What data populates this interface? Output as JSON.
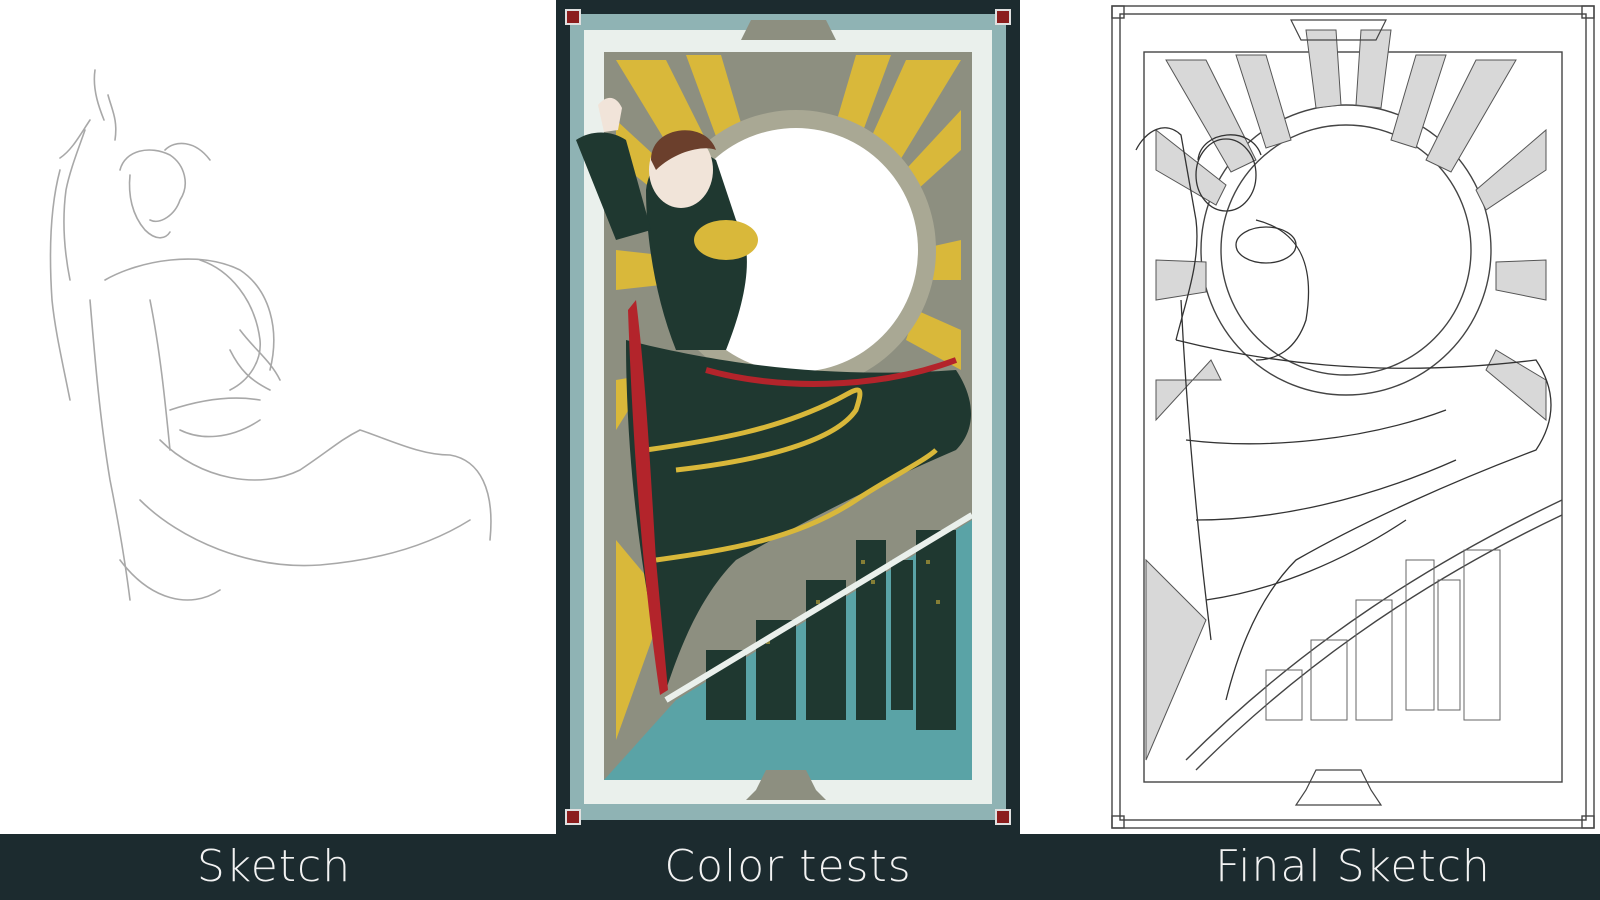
{
  "captions": {
    "sketch": "Sketch",
    "color": "Color tests",
    "final": "Final Sketch"
  },
  "colors": {
    "caption_bar": "#1c2b2f",
    "caption_text": "#f2f2f2",
    "frame_dark": "#1c2b2f",
    "frame_teal": "#8fb3b4",
    "gold": "#d9b83a",
    "grey_ray": "#8d8f80",
    "coat_green": "#1f3830",
    "sky_teal": "#5aa3a6",
    "sash_red": "#b3242b"
  },
  "panels": [
    {
      "id": "sketch",
      "style": "rough pencil gesture sketch"
    },
    {
      "id": "color",
      "style": "art deco card colored test"
    },
    {
      "id": "final",
      "style": "clean line art"
    }
  ]
}
